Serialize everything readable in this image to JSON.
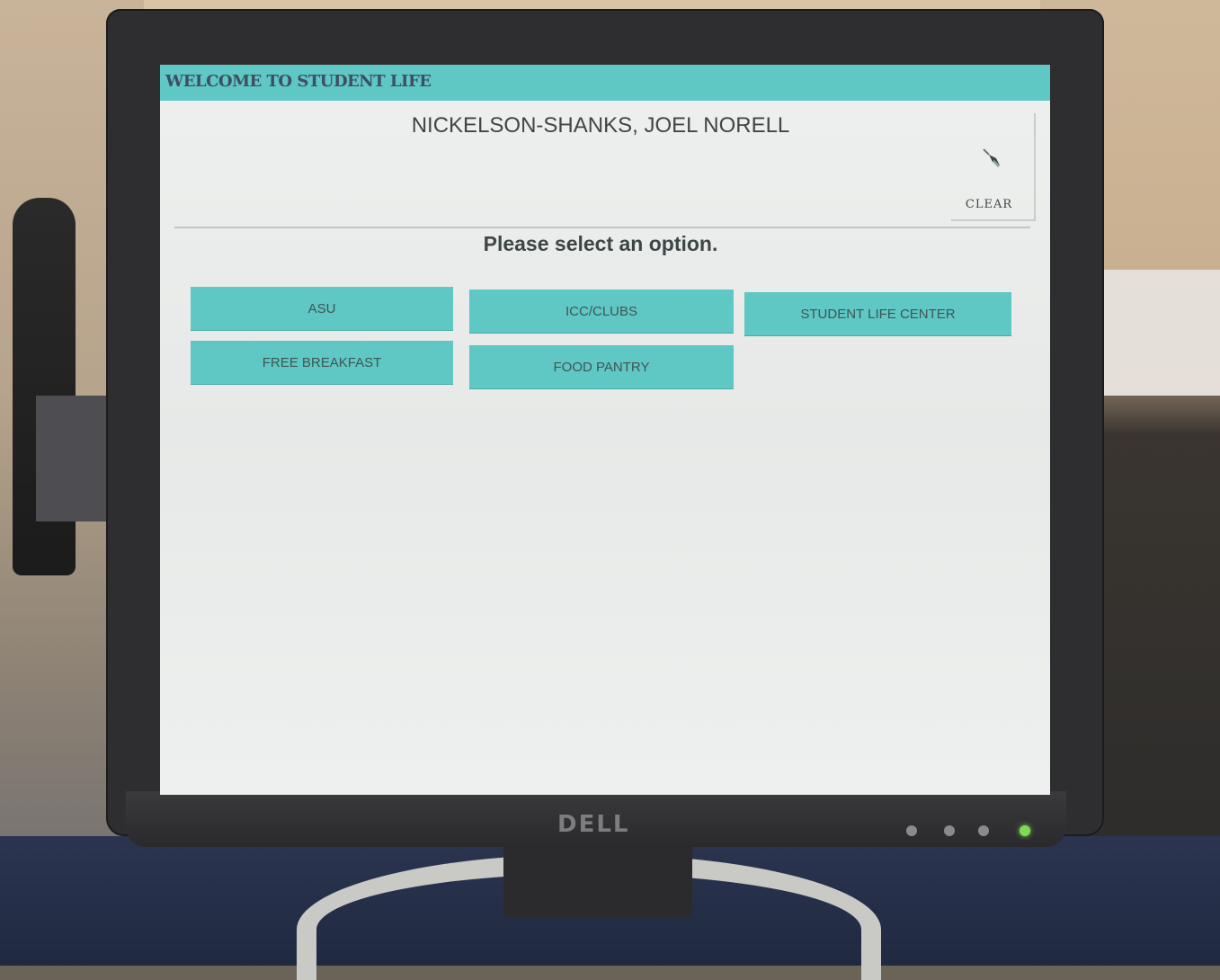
{
  "app": {
    "title": "WELCOME TO STUDENT LIFE",
    "accent_color": "#5fc7c4"
  },
  "header": {
    "student_name": "NICKELSON-SHANKS, JOEL NORELL",
    "clear_label": "CLEAR",
    "clear_icon": "eraser-icon"
  },
  "main": {
    "prompt": "Please select an option.",
    "options": [
      {
        "label": "ASU"
      },
      {
        "label": "ICC/CLUBS"
      },
      {
        "label": "STUDENT LIFE CENTER"
      },
      {
        "label": "FREE BREAKFAST"
      },
      {
        "label": "FOOD PANTRY"
      }
    ]
  }
}
